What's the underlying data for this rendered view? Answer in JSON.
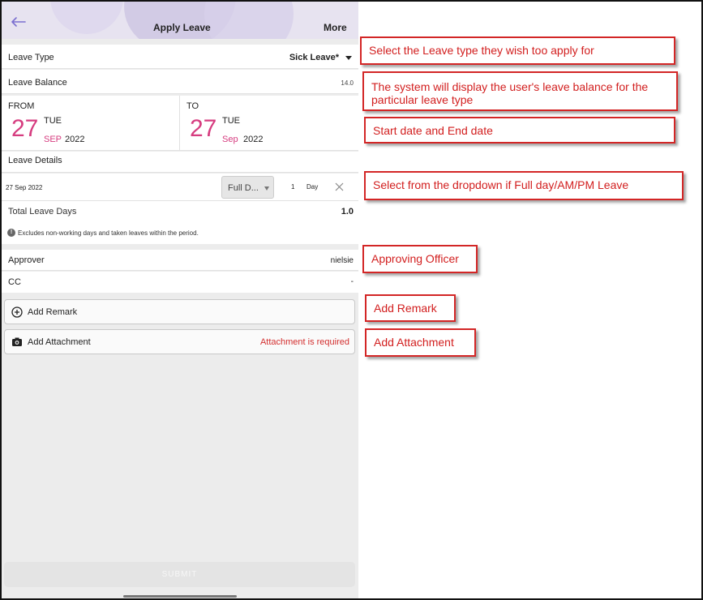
{
  "header": {
    "title": "Apply Leave",
    "more_label": "More"
  },
  "leave_type": {
    "label": "Leave Type",
    "value": "Sick Leave*"
  },
  "leave_balance": {
    "label": "Leave Balance",
    "value": "14.0"
  },
  "dates": {
    "from": {
      "label": "FROM",
      "day": "27",
      "weekday": "TUE",
      "month": "SEP",
      "year": "2022"
    },
    "to": {
      "label": "TO",
      "day": "27",
      "weekday": "TUE",
      "month": "Sep",
      "year": "2022"
    }
  },
  "leave_details": {
    "label": "Leave Details",
    "items": [
      {
        "date": "27 Sep 2022",
        "day_type": "Full D...",
        "qty": "1",
        "unit": "Day"
      }
    ]
  },
  "total": {
    "label": "Total Leave Days",
    "value": "1.0"
  },
  "note": "Excludes non-working days and taken leaves within the period.",
  "approver": {
    "label": "Approver",
    "value": "nielsie"
  },
  "cc": {
    "label": "CC",
    "value": "-"
  },
  "actions": {
    "remark_label": "Add Remark",
    "attachment_label": "Add Attachment",
    "attachment_required": "Attachment is required"
  },
  "submit_label": "SUBMIT",
  "callouts": [
    "Select the Leave type they wish too apply for",
    "The system will display the user's leave balance for the particular leave type",
    "Start date and End date",
    "Select from the dropdown if Full day/AM/PM Leave",
    "Approving Officer",
    "Add Remark",
    "Add Attachment"
  ],
  "colors": {
    "accent": "#d63c7f",
    "header_bg": "#e7e3f0",
    "callout_red": "#d21e1e",
    "required_red": "#d32f2f"
  },
  "icons": [
    "back-arrow-icon",
    "caret-down-icon",
    "close-icon",
    "info-icon",
    "plus-circle-icon",
    "camera-icon"
  ]
}
